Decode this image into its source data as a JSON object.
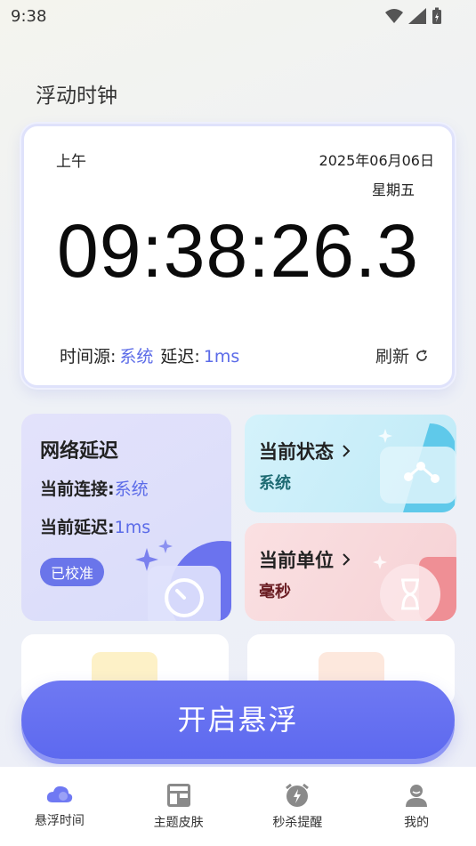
{
  "status_bar": {
    "time": "9:38"
  },
  "page_title": "浮动时钟",
  "clock": {
    "ampm": "上午",
    "date": "2025年06月06日",
    "weekday": "星期五",
    "time": "09:38:26.3",
    "source_label": "时间源:",
    "source_value": "系统",
    "delay_label": "延迟:",
    "delay_value": "1ms",
    "refresh_label": "刷新"
  },
  "network": {
    "title": "网络延迟",
    "connection_label": "当前连接:",
    "connection_value": "系统",
    "delay_label": "当前延迟:",
    "delay_value": "1ms",
    "badge": "已校准"
  },
  "state_card": {
    "title": "当前状态",
    "value": "系统"
  },
  "unit_card": {
    "title": "当前单位",
    "value": "毫秒"
  },
  "start_button": "开启悬浮",
  "nav": [
    {
      "label": "悬浮时间",
      "icon": "cloud-icon"
    },
    {
      "label": "主题皮肤",
      "icon": "layout-icon"
    },
    {
      "label": "秒杀提醒",
      "icon": "alarm-icon"
    },
    {
      "label": "我的",
      "icon": "user-icon"
    }
  ],
  "colors": {
    "accent": "#5d69ef",
    "link": "#5b6be8"
  }
}
